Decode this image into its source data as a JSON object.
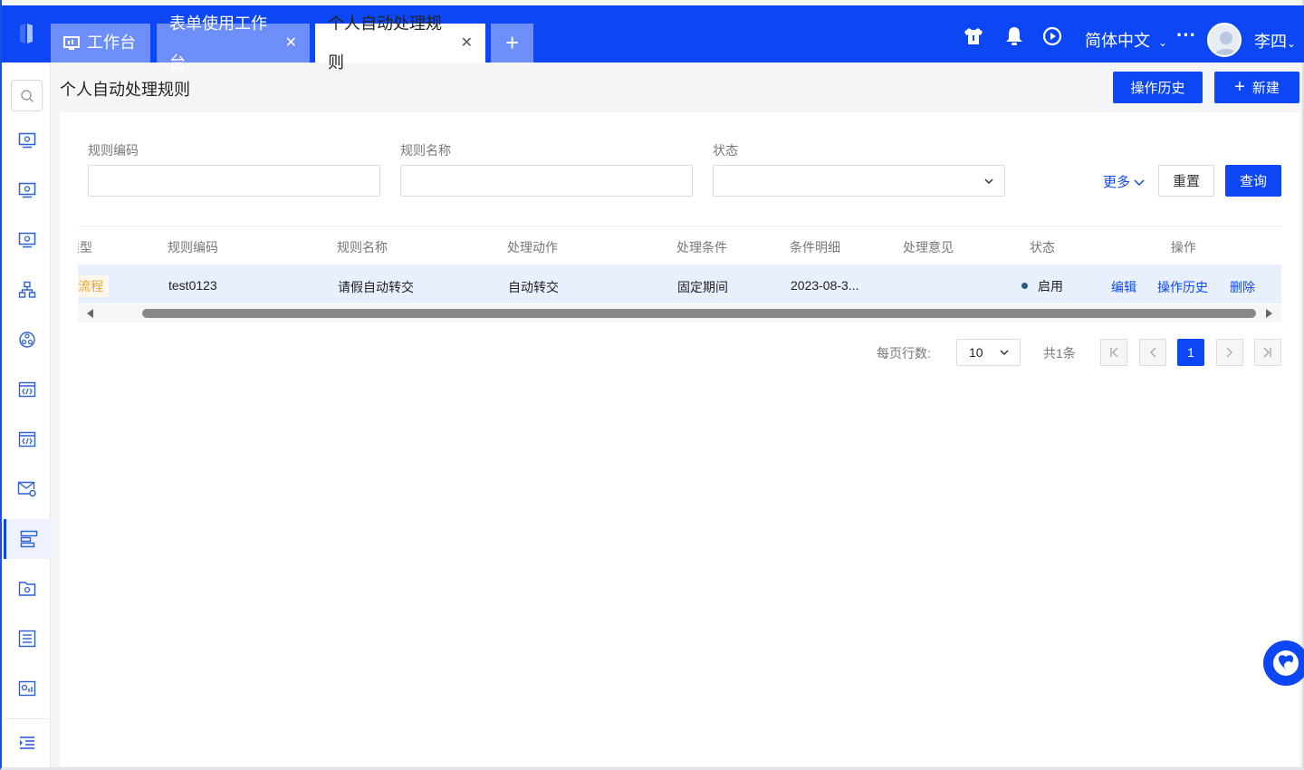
{
  "topbar": {
    "tabs": [
      {
        "label": "工作台",
        "icon": "monitor-icon",
        "closable": false
      },
      {
        "label": "表单使用工作台",
        "closable": true
      },
      {
        "label": "个人自动处理规则",
        "closable": true,
        "active": true
      }
    ],
    "close_glyph": "✕",
    "add_tab_glyph": "+",
    "language": "简体中文",
    "more_glyph": "···",
    "user_name": "李四"
  },
  "sidebar": {
    "items": [
      "app-icon",
      "app-icon",
      "app-icon",
      "org-icon",
      "network-icon",
      "code-window-icon",
      "code-window-icon",
      "mail-settings-icon",
      "flow-icon",
      "folder-settings-icon",
      "list-settings-icon",
      "chart-settings-icon"
    ],
    "active_index": 8
  },
  "page": {
    "title": "个人自动处理规则",
    "history_button": "操作历史",
    "new_button": "新建",
    "new_glyph": "+"
  },
  "filters": {
    "code_label": "规则编码",
    "name_label": "规则名称",
    "status_label": "状态",
    "more_label": "更多",
    "reset_label": "重置",
    "query_label": "查询"
  },
  "table": {
    "columns": [
      "类型",
      "规则编码",
      "规则名称",
      "处理动作",
      "处理条件",
      "条件明细",
      "处理意见",
      "状态",
      "操作"
    ],
    "rows": [
      {
        "type": "流程",
        "code": "test0123",
        "name": "请假自动转交",
        "action": "自动转交",
        "condition": "固定期间",
        "detail": "2023-08-3...",
        "opinion": "",
        "status": "启用",
        "ops": [
          "编辑",
          "操作历史",
          "删除"
        ]
      }
    ]
  },
  "pagination": {
    "rows_per_page_label": "每页行数:",
    "page_size": "10",
    "total_label": "共1条",
    "current_page": "1"
  },
  "colors": {
    "primary": "#0d47f5",
    "tag_bg": "#fff7ea",
    "tag_text": "#f1a33a"
  }
}
